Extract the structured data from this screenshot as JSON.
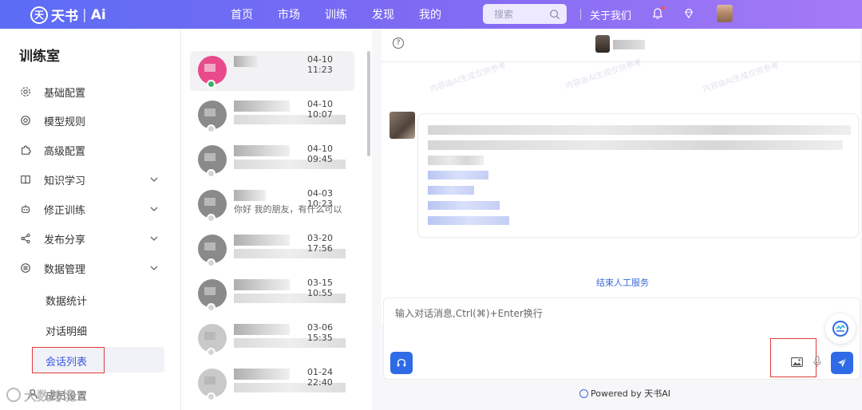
{
  "header": {
    "logo_text": "天书",
    "logo_suffix": "Ai",
    "nav": [
      "首页",
      "市场",
      "训练",
      "发现",
      "我的"
    ],
    "search_placeholder": "搜索",
    "about": "关于我们",
    "brand_color": "#6a6cf4"
  },
  "sidebar": {
    "title": "训练室",
    "items": [
      {
        "label": "基础配置",
        "icon": "gear-icon"
      },
      {
        "label": "模型规则",
        "icon": "target-icon"
      },
      {
        "label": "高级配置",
        "icon": "puzzle-icon"
      },
      {
        "label": "知识学习",
        "icon": "book-icon",
        "expandable": true
      },
      {
        "label": "修正训练",
        "icon": "robot-icon",
        "expandable": true
      },
      {
        "label": "发布分享",
        "icon": "share-icon",
        "expandable": true
      },
      {
        "label": "数据管理",
        "icon": "list-icon",
        "expandable": true,
        "expanded": true
      }
    ],
    "sub_items": [
      "数据统计",
      "对话明细",
      "会话列表"
    ],
    "active_sub": "会话列表",
    "member_label": "成员设置"
  },
  "conversations": [
    {
      "time": "04-10 11:23",
      "avatar": "pink",
      "online": true,
      "active": true,
      "preview": ""
    },
    {
      "time": "04-10 10:07",
      "avatar": "gray",
      "online": false,
      "preview": ""
    },
    {
      "time": "04-10 09:45",
      "avatar": "gray",
      "online": false,
      "preview": ""
    },
    {
      "time": "04-03 10:23",
      "avatar": "gray",
      "online": false,
      "preview": "你好    我的朋友，有什么可以"
    },
    {
      "time": "03-20 17:56",
      "avatar": "gray",
      "online": false,
      "preview": ""
    },
    {
      "time": "03-15 10:55",
      "avatar": "gray",
      "online": false,
      "preview": ""
    },
    {
      "time": "03-06 15:35",
      "avatar": "light",
      "online": false,
      "preview": ""
    },
    {
      "time": "01-24 22:40",
      "avatar": "light",
      "online": false,
      "preview": ""
    }
  ],
  "chat": {
    "help": "?",
    "end_service": "结束人工服务",
    "input_placeholder": "输入对话消息,Ctrl(⌘)+Enter换行",
    "powered_by": "Powered by 天书AI",
    "watermark": "内容由AI生成仅供参考"
  },
  "overlay": {
    "corner_watermark": "大数跨境"
  }
}
